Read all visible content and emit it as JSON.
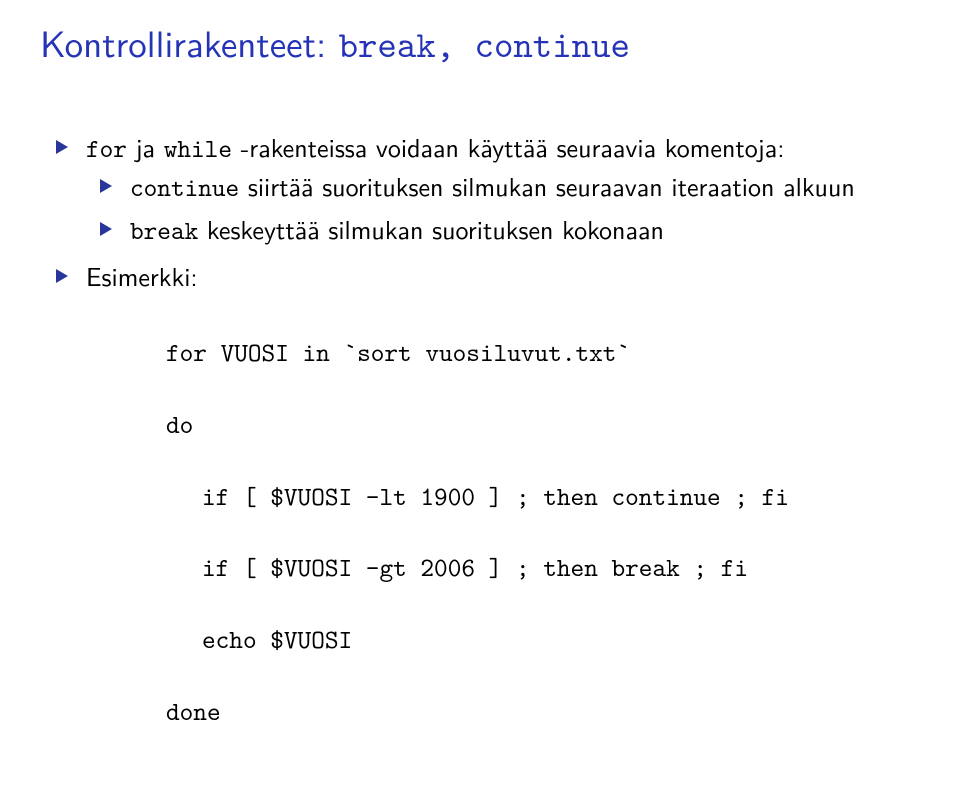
{
  "title_prefix": "Kontrollirakenteet: ",
  "title_code": "break, continue",
  "bullet1_a": "for",
  "bullet1_b": " ja ",
  "bullet1_c": "while",
  "bullet1_d": " -rakenteissa voidaan käyttää seuraavia komentoja:",
  "sub1_a": "continue",
  "sub1_b": " siirtää suorituksen silmukan seuraavan iteraation alkuun",
  "sub2_a": "break",
  "sub2_b": " keskeyttää silmukan suorituksen kokonaan",
  "bullet2": "Esimerkki:",
  "code": {
    "l1": "for VUOSI in `sort vuosiluvut.txt`",
    "l2": "do",
    "l3": "if [ $VUOSI -lt 1900 ] ; then continue ; fi",
    "l4": "if [ $VUOSI -gt 2006 ] ; then break ; fi",
    "l5": "echo $VUOSI",
    "l6": "done"
  }
}
